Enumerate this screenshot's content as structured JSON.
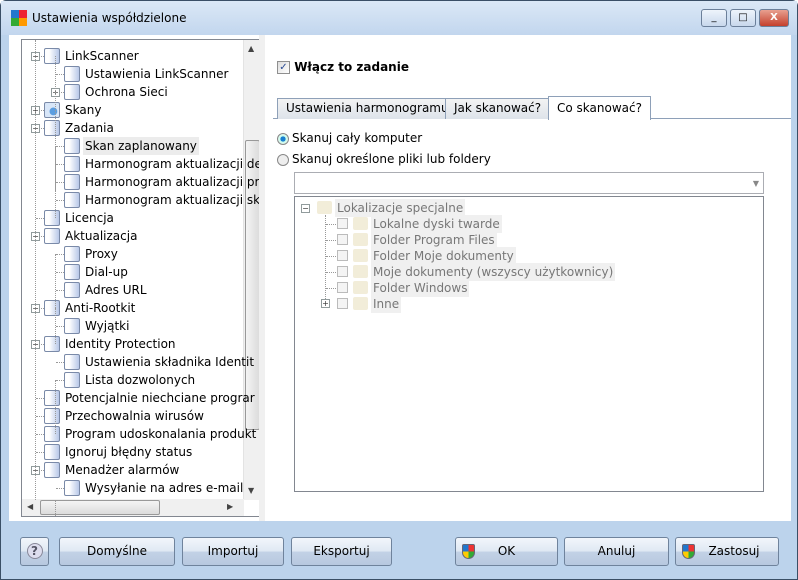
{
  "window": {
    "title": "Ustawienia współdzielone",
    "controls": [
      "_",
      "□",
      "X"
    ]
  },
  "tree": {
    "items": [
      {
        "label": "LinkScanner",
        "level": 0,
        "exp": "-",
        "icon": "doc"
      },
      {
        "label": "Ustawienia LinkScanner",
        "level": 1,
        "icon": "doc"
      },
      {
        "label": "Ochrona Sieci",
        "level": 1,
        "exp": "+",
        "icon": "doc"
      },
      {
        "label": "Skany",
        "level": 0,
        "exp": "+",
        "icon": "scan"
      },
      {
        "label": "Zadania",
        "level": 0,
        "exp": "-",
        "icon": "task"
      },
      {
        "label": "Skan zaplanowany",
        "level": 1,
        "icon": "task",
        "selected": true
      },
      {
        "label": "Harmonogram aktualizacji de",
        "level": 1,
        "icon": "task"
      },
      {
        "label": "Harmonogram aktualizacji pr",
        "level": 1,
        "icon": "task"
      },
      {
        "label": "Harmonogram aktualizacji sk",
        "level": 1,
        "icon": "task"
      },
      {
        "label": "Licencja",
        "level": 0,
        "icon": "doc"
      },
      {
        "label": "Aktualizacja",
        "level": 0,
        "exp": "-",
        "icon": "doc"
      },
      {
        "label": "Proxy",
        "level": 1,
        "icon": "doc"
      },
      {
        "label": "Dial-up",
        "level": 1,
        "icon": "doc"
      },
      {
        "label": "Adres URL",
        "level": 1,
        "icon": "doc"
      },
      {
        "label": "Anti-Rootkit",
        "level": 0,
        "exp": "-",
        "icon": "doc"
      },
      {
        "label": "Wyjątki",
        "level": 1,
        "icon": "doc"
      },
      {
        "label": "Identity Protection",
        "level": 0,
        "exp": "-",
        "icon": "doc"
      },
      {
        "label": "Ustawienia składnika Identit",
        "level": 1,
        "icon": "doc"
      },
      {
        "label": "Lista dozwolonych",
        "level": 1,
        "icon": "doc"
      },
      {
        "label": "Potencjalnie niechciane prograr",
        "level": 0,
        "icon": "doc"
      },
      {
        "label": "Przechowalnia wirusów",
        "level": 0,
        "icon": "doc"
      },
      {
        "label": "Program udoskonalania produkt",
        "level": 0,
        "icon": "doc"
      },
      {
        "label": "Ignoruj błędny status",
        "level": 0,
        "icon": "doc"
      },
      {
        "label": "Menadżer alarmów",
        "level": 0,
        "exp": "-",
        "icon": "doc"
      },
      {
        "label": "Wysyłanie na adres e-mail",
        "level": 1,
        "icon": "doc"
      }
    ]
  },
  "main": {
    "enable_label": "Włącz to zadanie",
    "enable_checked": true,
    "tabs": [
      {
        "label": "Ustawienia harmonogramu"
      },
      {
        "label": "Jak skanować?"
      },
      {
        "label": "Co skanować?",
        "active": true
      }
    ],
    "radio_whole": "Skanuj cały komputer",
    "radio_specific": "Skanuj określone pliki lub foldery",
    "selected_radio": "whole",
    "path_value": "",
    "locations": {
      "root": "Lokalizacje specjalne",
      "items": [
        "Lokalne dyski twarde",
        "Folder Program Files",
        "Folder Moje dokumenty",
        "Moje dokumenty (wszyscy użytkownicy)",
        "Folder Windows",
        "Inne"
      ]
    }
  },
  "buttons": {
    "help": "?",
    "defaults": "Domyślne",
    "import": "Importuj",
    "export": "Eksportuj",
    "ok": "OK",
    "cancel": "Anuluj",
    "apply": "Zastosuj"
  }
}
